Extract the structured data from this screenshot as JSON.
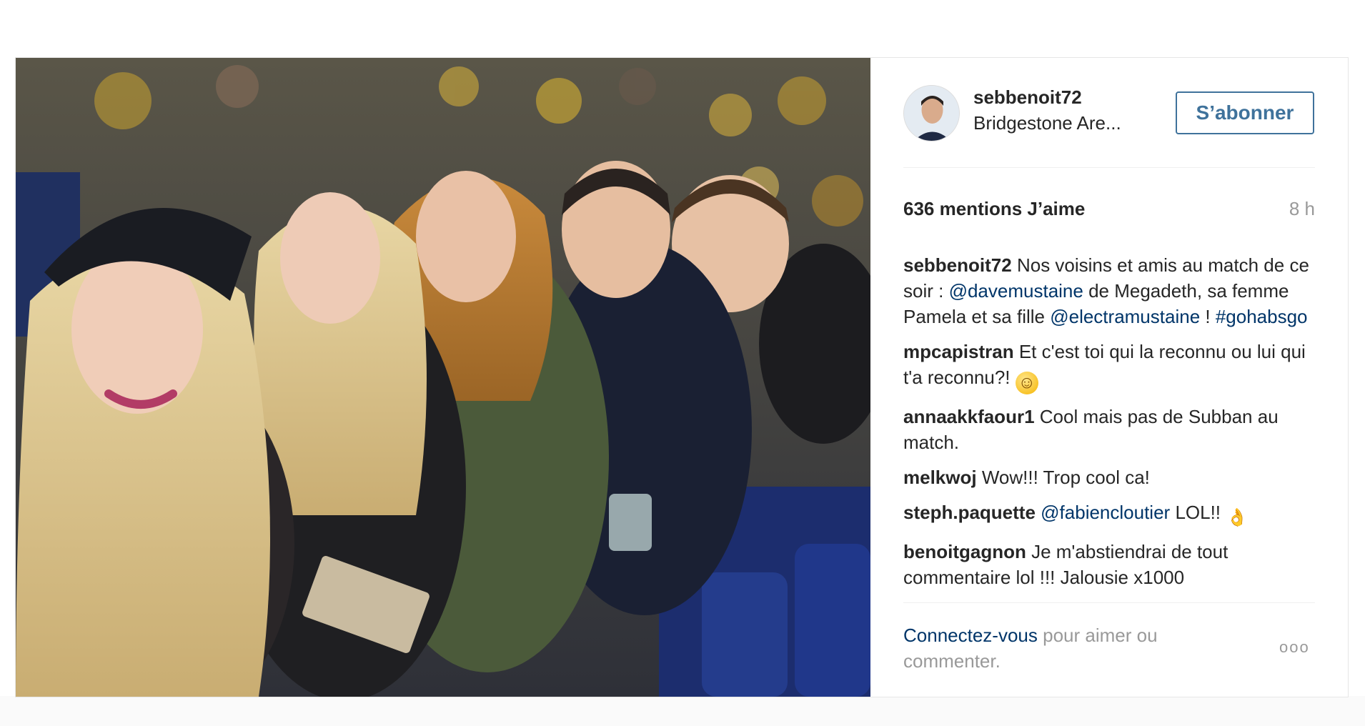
{
  "post": {
    "username": "sebbenoit72",
    "location": "Bridgestone Are...",
    "follow_label": "S’abonner",
    "likes": "636 mentions J’aime",
    "time": "8 h"
  },
  "comments": [
    {
      "user": "sebbenoit72",
      "parts": [
        {
          "t": "Nos voisins et amis au match de ce soir : "
        },
        {
          "t": "@davemustaine",
          "link": true
        },
        {
          "t": " de Megadeth, sa femme Pamela et sa fille "
        },
        {
          "t": "@electramustaine",
          "link": true
        },
        {
          "t": " ! "
        },
        {
          "t": "#gohabsgo",
          "link": true
        }
      ]
    },
    {
      "user": "mpcapistran",
      "parts": [
        {
          "t": "Et c'est toi qui la reconnu ou lui qui t'a reconnu?! "
        },
        {
          "emoji": "smile"
        }
      ]
    },
    {
      "user": "annaakkfaour1",
      "parts": [
        {
          "t": "Cool mais pas de Subban au match."
        }
      ]
    },
    {
      "user": "melkwoj",
      "parts": [
        {
          "t": "Wow!!! Trop cool ca!"
        }
      ]
    },
    {
      "user": "steph.paquette",
      "parts": [
        {
          "t": "@fabiencloutier",
          "link": true
        },
        {
          "t": " LOL!! "
        },
        {
          "emoji": "ok"
        }
      ]
    },
    {
      "user": "benoitgagnon",
      "parts": [
        {
          "t": "Je m'abstiendrai de tout commentaire lol !!! Jalousie x1000"
        }
      ]
    }
  ],
  "footer": {
    "login_link": "Connectez-vous",
    "login_rest": " pour aimer ou commenter.",
    "more_label": "ooo"
  },
  "icons": {
    "emoji_smile": "smiling-face-emoji",
    "emoji_ok": "ok-hand-emoji"
  },
  "colors": {
    "link": "#003569",
    "follow_button": "#3f729b",
    "muted": "#999999",
    "text": "#262626"
  }
}
